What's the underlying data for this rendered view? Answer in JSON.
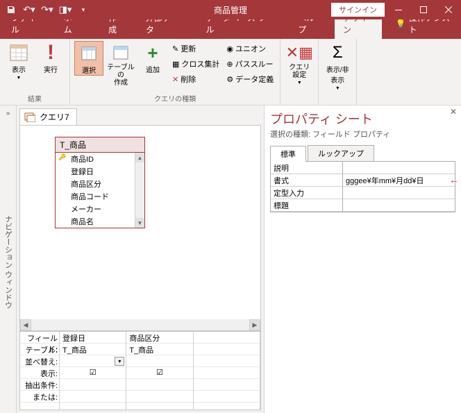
{
  "titlebar": {
    "app_title": "商品管理",
    "signin": "サインイン"
  },
  "tabs": {
    "file": "ファイル",
    "home": "ホーム",
    "create": "作成",
    "external": "外部データ",
    "dbtools": "データベース ツール",
    "help": "ヘルプ",
    "design": "デザイン",
    "tell_me": "操作アシスト"
  },
  "ribbon": {
    "g1": {
      "view": "表示",
      "run": "実行",
      "label": "結果"
    },
    "g2": {
      "select": "選択",
      "make_table": "テーブルの\n作成",
      "append": "追加",
      "update": "更新",
      "crosstab": "クロス集計",
      "delete": "削除",
      "union": "ユニオン",
      "passthrough": "パススルー",
      "datadef": "データ定義",
      "label": "クエリの種類"
    },
    "g3": {
      "settings": "クエリ\n設定"
    },
    "g4": {
      "showhide": "表示/非表示"
    }
  },
  "nav": {
    "title": "ナビゲーション ウィンドウ"
  },
  "query": {
    "tab": "クエリ7",
    "table": {
      "name": "T_商品",
      "fields": [
        "商品ID",
        "登録日",
        "商品区分",
        "商品コード",
        "メーカー",
        "商品名"
      ]
    },
    "grid": {
      "labels": {
        "field": "フィールド:",
        "table": "テーブル:",
        "sort": "並べ替え:",
        "show": "表示:",
        "criteria": "抽出条件:",
        "or": "または:"
      },
      "cols": [
        {
          "field": "登録日",
          "table": "T_商品",
          "sort": "",
          "show": true
        },
        {
          "field": "商品区分",
          "table": "T_商品",
          "sort": "",
          "show": true
        }
      ]
    }
  },
  "prop": {
    "title": "プロパティ シート",
    "subtitle": "選択の種類: フィールド プロパティ",
    "tabs": {
      "general": "標準",
      "lookup": "ルックアップ"
    },
    "rows": {
      "description": {
        "lbl": "説明",
        "val": ""
      },
      "format": {
        "lbl": "書式",
        "val": "gggee¥年mm¥月dd¥日"
      },
      "input_mask": {
        "lbl": "定型入力",
        "val": ""
      },
      "caption": {
        "lbl": "標題",
        "val": ""
      }
    }
  }
}
